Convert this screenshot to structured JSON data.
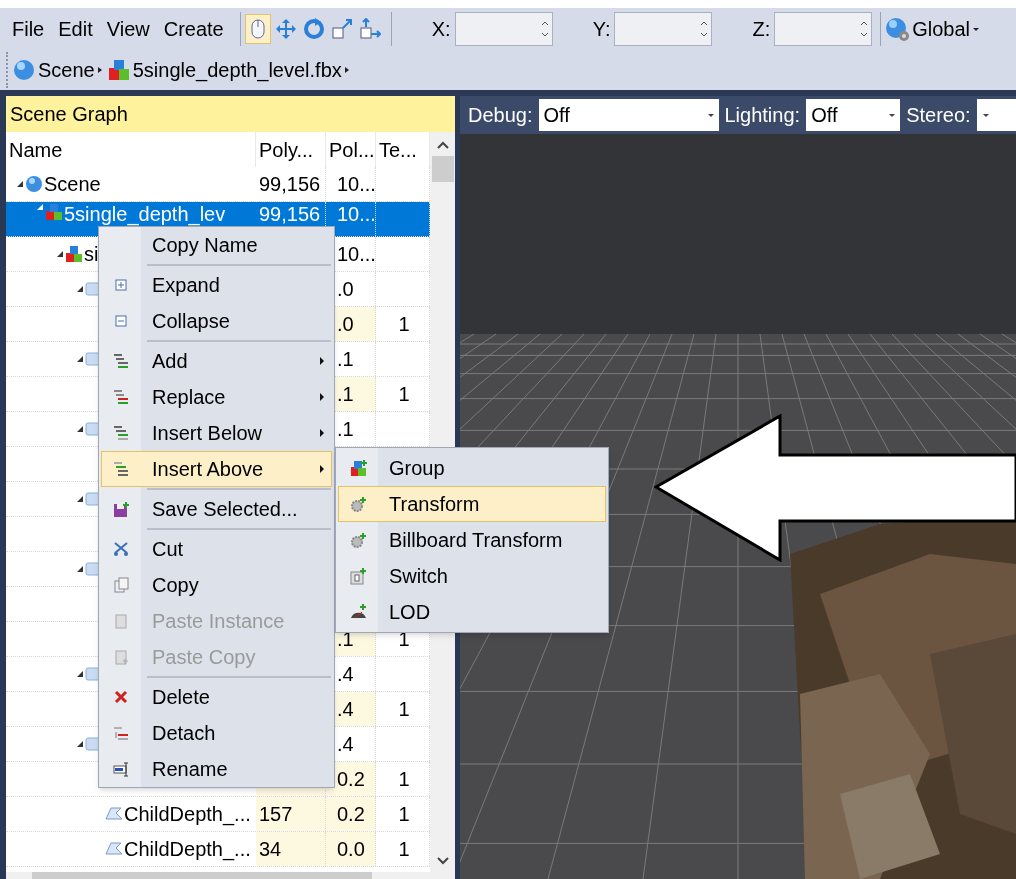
{
  "menu_bar": [
    "File",
    "Edit",
    "View",
    "Create"
  ],
  "tools": [
    {
      "selected": true
    },
    {
      "selected": false
    },
    {
      "selected": false
    },
    {
      "selected": false
    },
    {
      "selected": false
    }
  ],
  "coordinates": [
    {
      "label": "X:"
    },
    {
      "label": "Y:"
    },
    {
      "label": "Z:"
    }
  ],
  "space_dropdown": {
    "value": "Global"
  },
  "breadcrumb": [
    "Scene",
    "5single_depth_level.fbx"
  ],
  "scene_graph": {
    "title": "Scene Graph",
    "columns": [
      "Name",
      "Poly...",
      "Pol...",
      "Te..."
    ],
    "rows": [
      {
        "name": "Scene",
        "kind": "scene",
        "poly": "99,156",
        "pol": "10...",
        "expanded": true,
        "selected": false,
        "children": [
          {
            "name": "5single_depth_lev",
            "kind": "group",
            "poly": "99,156",
            "pol": "10...",
            "expanded": true,
            "selected": true,
            "children": [
              {
                "name": "si",
                "kind": "group",
                "pol": "10...",
                "expanded": true,
                "selected": false,
                "children": [
                  {
                    "kind": "node",
                    "pol": ".0",
                    "expanded": true,
                    "selected": false,
                    "children": [
                      {
                        "kind": "mesh",
                        "pol": ".0",
                        "te": "1",
                        "selected": false
                      }
                    ]
                  },
                  {
                    "kind": "node",
                    "pol": ".1",
                    "expanded": true,
                    "selected": false,
                    "children": [
                      {
                        "kind": "mesh",
                        "pol": ".1",
                        "te": "1",
                        "selected": false
                      }
                    ]
                  },
                  {
                    "kind": "node",
                    "pol": ".1",
                    "expanded": true,
                    "selected": false,
                    "children": [
                      {
                        "kind": "mesh",
                        "selected": false
                      }
                    ]
                  },
                  {
                    "kind": "node",
                    "expanded": true,
                    "selected": false,
                    "children": [
                      {
                        "kind": "mesh",
                        "selected": false
                      }
                    ]
                  },
                  {
                    "kind": "node",
                    "expanded": true,
                    "selected": false,
                    "children": [
                      {
                        "kind": "mesh",
                        "selected": false
                      },
                      {
                        "kind": "mesh",
                        "pol": ".1",
                        "te": "1",
                        "selected": false
                      }
                    ]
                  },
                  {
                    "kind": "node",
                    "pol": ".4",
                    "expanded": true,
                    "selected": false,
                    "children": [
                      {
                        "kind": "mesh",
                        "pol": ".4",
                        "te": "1",
                        "selected": false
                      }
                    ]
                  },
                  {
                    "kind": "node",
                    "pol": ".4",
                    "expanded": true,
                    "selected": false,
                    "children": [
                      {
                        "kind": "mesh",
                        "pol": "0.2",
                        "te": "1",
                        "selected": false
                      },
                      {
                        "name": "ChildDepth_...",
                        "kind": "mesh",
                        "poly": "157",
                        "pol": "0.2",
                        "te": "1",
                        "selected": false
                      },
                      {
                        "name": "ChildDepth_...",
                        "kind": "mesh",
                        "poly": "34",
                        "pol": "0.0",
                        "te": "1",
                        "selected": false
                      }
                    ]
                  }
                ]
              }
            ]
          }
        ]
      }
    ]
  },
  "context_menu": [
    {
      "label": "Copy Name",
      "disabled": false,
      "selected": false,
      "submenu": false,
      "separator_before": false
    },
    {
      "label": "Expand",
      "disabled": false,
      "selected": false,
      "submenu": false,
      "separator_before": true
    },
    {
      "label": "Collapse",
      "disabled": false,
      "selected": false,
      "submenu": false,
      "separator_before": false
    },
    {
      "label": "Add",
      "disabled": false,
      "selected": false,
      "submenu": true,
      "separator_before": true
    },
    {
      "label": "Replace",
      "disabled": false,
      "selected": false,
      "submenu": true,
      "separator_before": false
    },
    {
      "label": "Insert Below",
      "disabled": false,
      "selected": false,
      "submenu": true,
      "separator_before": false
    },
    {
      "label": "Insert Above",
      "disabled": false,
      "selected": true,
      "submenu": true,
      "separator_before": false
    },
    {
      "label": "Save Selected...",
      "disabled": false,
      "selected": false,
      "submenu": false,
      "separator_before": true
    },
    {
      "label": "Cut",
      "disabled": false,
      "selected": false,
      "submenu": false,
      "separator_before": true
    },
    {
      "label": "Copy",
      "disabled": false,
      "selected": false,
      "submenu": false,
      "separator_before": false
    },
    {
      "label": "Paste Instance",
      "disabled": true,
      "selected": false,
      "submenu": false,
      "separator_before": false
    },
    {
      "label": "Paste Copy",
      "disabled": true,
      "selected": false,
      "submenu": false,
      "separator_before": false
    },
    {
      "label": "Delete",
      "disabled": false,
      "selected": false,
      "submenu": false,
      "separator_before": true
    },
    {
      "label": "Detach",
      "disabled": false,
      "selected": false,
      "submenu": false,
      "separator_before": false
    },
    {
      "label": "Rename",
      "disabled": false,
      "selected": false,
      "submenu": false,
      "separator_before": false
    }
  ],
  "submenu": [
    {
      "label": "Group",
      "selected": false
    },
    {
      "label": "Transform",
      "selected": true
    },
    {
      "label": "Billboard Transform",
      "selected": false
    },
    {
      "label": "Switch",
      "selected": false
    },
    {
      "label": "LOD",
      "selected": false
    }
  ],
  "viewport_toolbar": [
    {
      "label": "Debug:",
      "value": "Off"
    },
    {
      "label": "Lighting:",
      "value": "Off"
    },
    {
      "label": "Stereo:"
    }
  ]
}
